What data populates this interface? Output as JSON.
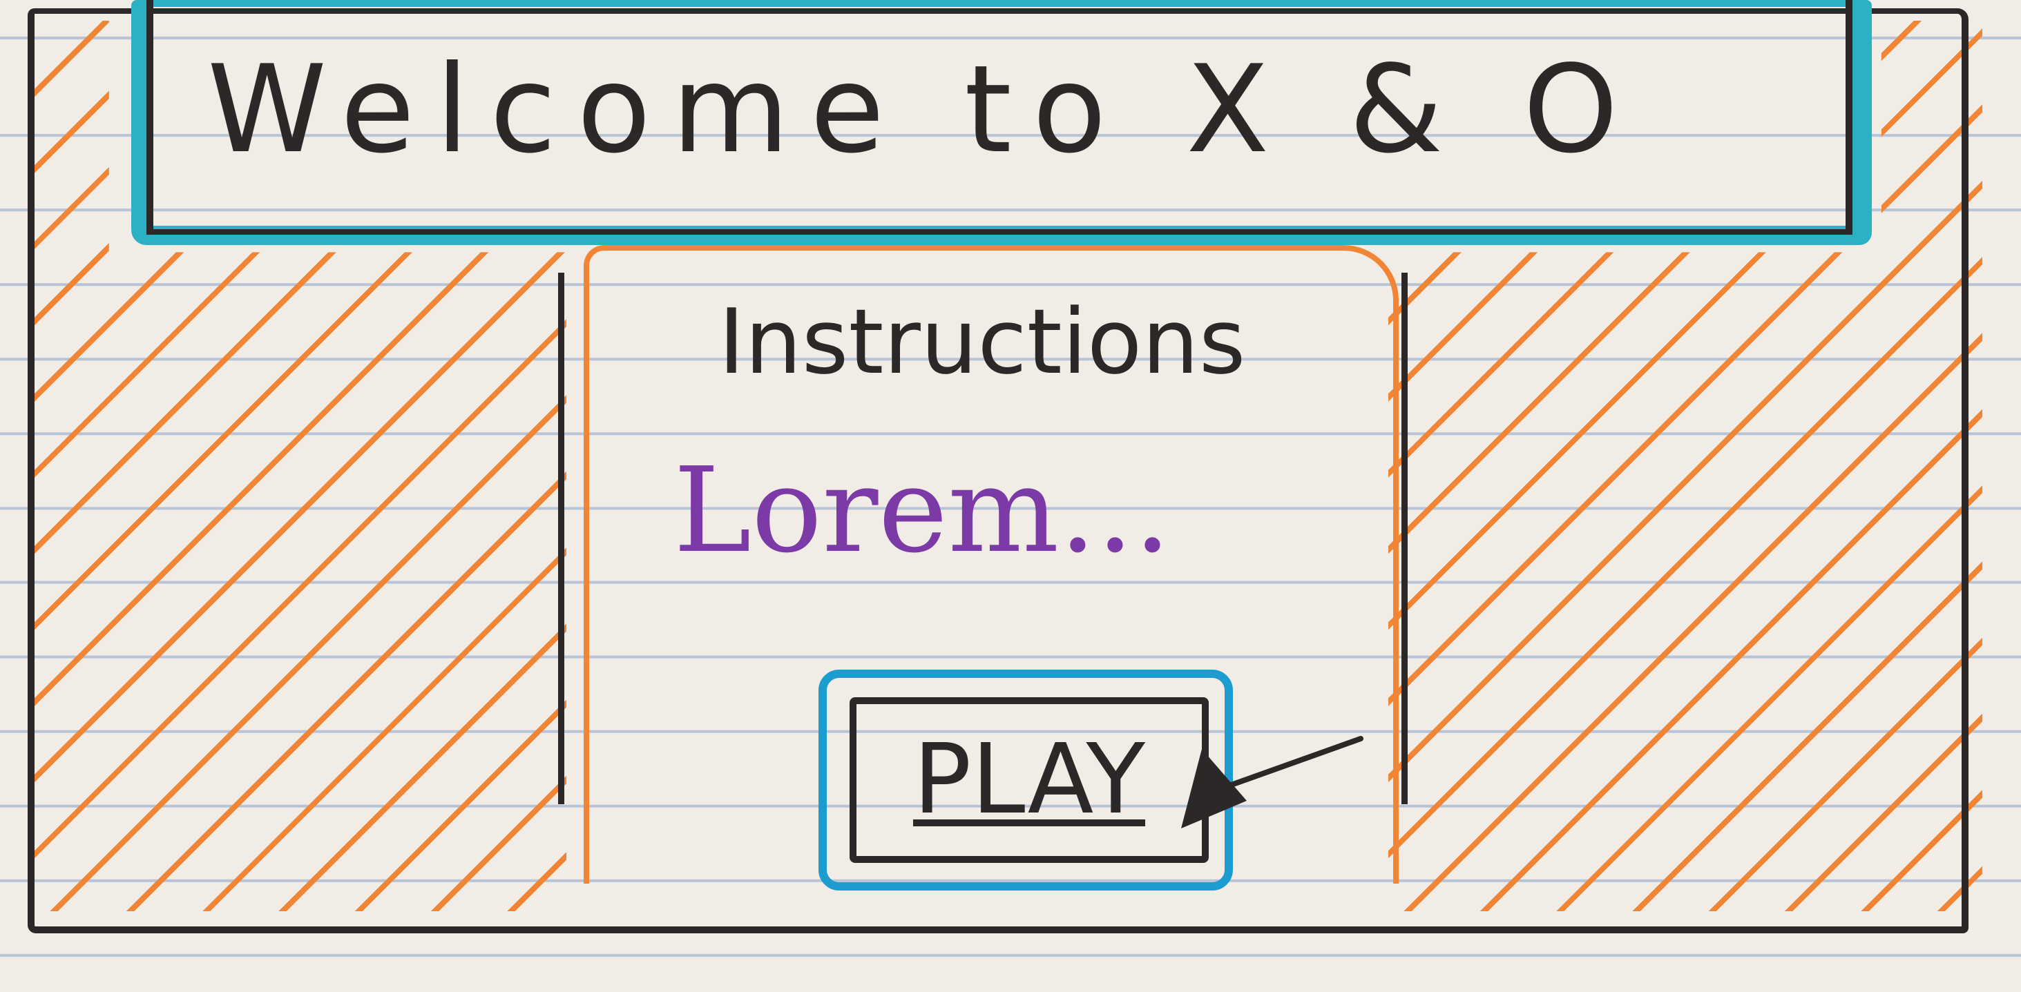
{
  "header": {
    "title": "Welcome to X & O"
  },
  "main": {
    "instructions_heading": "Instructions",
    "instructions_text": "Lorem...",
    "play_label": "PLAY"
  },
  "icons": {
    "cursor": "cursor-pointer-icon"
  },
  "colors": {
    "paper": "#f1ede6",
    "ink": "#2b2827",
    "header_highlight": "#2bb0c4",
    "hatch": "#f08536",
    "lorem": "#7b3aa6",
    "button_outline": "#1c9ccf"
  }
}
